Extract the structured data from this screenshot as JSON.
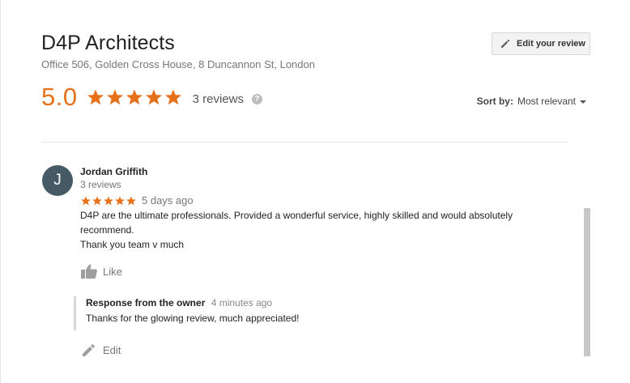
{
  "place": {
    "title": "D4P Architects",
    "address": "Office 506, Golden Cross House, 8 Duncannon St, London"
  },
  "toolbar": {
    "edit_review_label": "Edit your review"
  },
  "summary": {
    "rating": "5.0",
    "stars": 5,
    "review_count": "3 reviews",
    "help_glyph": "?"
  },
  "sort": {
    "label": "Sort by:",
    "value": "Most relevant"
  },
  "review": {
    "avatar_letter": "J",
    "avatar_color": "#455a64",
    "name": "Jordan Griffith",
    "meta": "3 reviews",
    "stars": 5,
    "time": "5 days ago",
    "text_line1": "D4P are the ultimate professionals. Provided a wonderful service, highly skilled and would absolutely",
    "text_line2": "recommend.",
    "text_line3": "Thank you team v much",
    "like_label": "Like"
  },
  "owner_response": {
    "title": "Response from the owner",
    "time": "4 minutes ago",
    "text": "Thanks for the glowing review, much appreciated!"
  },
  "edit": {
    "label": "Edit"
  },
  "colors": {
    "accent_orange": "#e7711b",
    "muted_text": "#777777"
  },
  "icons": {
    "edit_review": "pencil-icon",
    "star": "star-icon",
    "help": "help-circle-icon",
    "sort_caret": "caret-down-icon",
    "like": "thumbs-up-icon",
    "edit": "pencil-icon"
  }
}
